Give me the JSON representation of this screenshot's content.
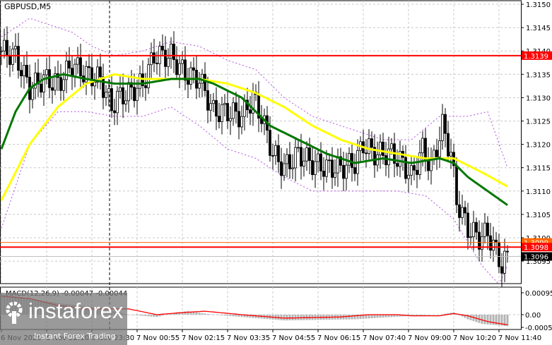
{
  "symbol": "GBPUSD,M5",
  "price_labels": [
    "1.3150",
    "1.3145",
    "1.3140",
    "1.3135",
    "1.3130",
    "1.3125",
    "1.3120",
    "1.3115",
    "1.3110",
    "1.3105",
    "1.3100",
    "1.3095"
  ],
  "markers": {
    "level_high": "1.3139",
    "level_low": "1.3098",
    "level_orange": "1.3099",
    "current": "1.3096"
  },
  "time_labels": [
    "6 Nov 2025",
    "6 Nov 22:10",
    "6 Nov 23:30",
    "7 Nov 00:55",
    "7 Nov 02:15",
    "7 Nov 03:35",
    "7 Nov 04:55",
    "7 Nov 06:15",
    "7 Nov 07:40",
    "7 Nov 09:00",
    "7 Nov 10:20",
    "7 Nov 11:40"
  ],
  "macd": {
    "label": "MACD(12,26,9) -0.00047 -0.00044",
    "axis": [
      "0.00095",
      "0.00",
      "-0.00055"
    ]
  },
  "watermark": {
    "brand": "instaforex",
    "tagline": "Instant Forex Trading"
  },
  "colors": {
    "ma_fast": "#007700",
    "ma_slow": "#ffff00",
    "bands": "#b050e0",
    "level": "#ff0000",
    "macd_signal": "#ff0000",
    "hist": "#b4b4b4"
  },
  "chart_data": {
    "type": "candlestick",
    "bars": 184,
    "close_waypoints": [
      [
        0,
        1.314
      ],
      [
        5,
        1.3139
      ],
      [
        10,
        1.3132
      ],
      [
        15,
        1.3134
      ],
      [
        20,
        1.3133
      ],
      [
        25,
        1.3137
      ],
      [
        30,
        1.3135
      ],
      [
        35,
        1.3134
      ],
      [
        39,
        1.3128
      ],
      [
        41,
        1.313
      ],
      [
        45,
        1.3131
      ],
      [
        50,
        1.3133
      ],
      [
        54,
        1.3139
      ],
      [
        60,
        1.3139
      ],
      [
        65,
        1.3135
      ],
      [
        70,
        1.3134
      ],
      [
        75,
        1.3127
      ],
      [
        80,
        1.3127
      ],
      [
        85,
        1.3126
      ],
      [
        89,
        1.313
      ],
      [
        92,
        1.3126
      ],
      [
        96,
        1.3118
      ],
      [
        100,
        1.3115
      ],
      [
        105,
        1.3118
      ],
      [
        110,
        1.3116
      ],
      [
        115,
        1.3115
      ],
      [
        120,
        1.3115
      ],
      [
        125,
        1.3116
      ],
      [
        128,
        1.312
      ],
      [
        132,
        1.3118
      ],
      [
        138,
        1.3118
      ],
      [
        142,
        1.3116
      ],
      [
        145,
        1.3113
      ],
      [
        149,
        1.3119
      ],
      [
        152,
        1.3115
      ],
      [
        156,
        1.3124
      ],
      [
        159,
        1.3118
      ],
      [
        161,
        1.3108
      ],
      [
        165,
        1.3102
      ],
      [
        169,
        1.31
      ],
      [
        172,
        1.3101
      ],
      [
        175,
        1.3097
      ],
      [
        177,
        1.3094
      ],
      [
        179,
        1.3096
      ]
    ],
    "ma_fast": [
      [
        0,
        1.3119
      ],
      [
        5,
        1.3127
      ],
      [
        10,
        1.3132
      ],
      [
        15,
        1.3134
      ],
      [
        22,
        1.3135
      ],
      [
        30,
        1.3134
      ],
      [
        40,
        1.3133
      ],
      [
        50,
        1.3133
      ],
      [
        60,
        1.3134
      ],
      [
        70,
        1.3134
      ],
      [
        75,
        1.3133
      ],
      [
        85,
        1.313
      ],
      [
        95,
        1.3124
      ],
      [
        105,
        1.3121
      ],
      [
        115,
        1.3118
      ],
      [
        125,
        1.3116
      ],
      [
        135,
        1.3117
      ],
      [
        145,
        1.3116
      ],
      [
        155,
        1.3117
      ],
      [
        160,
        1.3116
      ],
      [
        165,
        1.3113
      ],
      [
        172,
        1.311
      ],
      [
        179,
        1.3107
      ]
    ],
    "ma_slow": [
      [
        0,
        1.3108
      ],
      [
        10,
        1.312
      ],
      [
        20,
        1.3128
      ],
      [
        30,
        1.3133
      ],
      [
        40,
        1.3135
      ],
      [
        50,
        1.3134
      ],
      [
        60,
        1.3134
      ],
      [
        70,
        1.3134
      ],
      [
        80,
        1.3133
      ],
      [
        90,
        1.3131
      ],
      [
        100,
        1.3128
      ],
      [
        110,
        1.3124
      ],
      [
        120,
        1.3121
      ],
      [
        130,
        1.3119
      ],
      [
        140,
        1.3118
      ],
      [
        150,
        1.3117
      ],
      [
        160,
        1.3117
      ],
      [
        170,
        1.3114
      ],
      [
        179,
        1.3111
      ]
    ],
    "band_upper": [
      [
        0,
        1.3143
      ],
      [
        10,
        1.3147
      ],
      [
        15,
        1.3146
      ],
      [
        25,
        1.3144
      ],
      [
        32,
        1.3141
      ],
      [
        40,
        1.3139
      ],
      [
        50,
        1.314
      ],
      [
        60,
        1.3142
      ],
      [
        70,
        1.3141
      ],
      [
        80,
        1.3138
      ],
      [
        90,
        1.3136
      ],
      [
        100,
        1.313
      ],
      [
        110,
        1.3126
      ],
      [
        125,
        1.3123
      ],
      [
        135,
        1.3121
      ],
      [
        145,
        1.3121
      ],
      [
        155,
        1.3126
      ],
      [
        165,
        1.3126
      ],
      [
        172,
        1.3127
      ],
      [
        179,
        1.3115
      ]
    ],
    "band_lower": [
      [
        0,
        1.3102
      ],
      [
        10,
        1.312
      ],
      [
        20,
        1.3127
      ],
      [
        30,
        1.3127
      ],
      [
        40,
        1.3126
      ],
      [
        50,
        1.3126
      ],
      [
        60,
        1.3128
      ],
      [
        70,
        1.3124
      ],
      [
        80,
        1.3119
      ],
      [
        90,
        1.3117
      ],
      [
        100,
        1.3113
      ],
      [
        110,
        1.311
      ],
      [
        120,
        1.311
      ],
      [
        130,
        1.311
      ],
      [
        140,
        1.311
      ],
      [
        150,
        1.3109
      ],
      [
        160,
        1.3104
      ],
      [
        170,
        1.3094
      ],
      [
        176,
        1.309
      ],
      [
        179,
        1.3094
      ]
    ],
    "macd_hist": [
      [
        0,
        0.0009
      ],
      [
        10,
        0.0007
      ],
      [
        20,
        0.0005
      ],
      [
        35,
        0.0003
      ],
      [
        45,
        0.0
      ],
      [
        55,
        -0.0001
      ],
      [
        62,
        0.0001
      ],
      [
        66,
        0.00015
      ],
      [
        75,
        0.0
      ],
      [
        90,
        -0.00015
      ],
      [
        100,
        -0.00025
      ],
      [
        125,
        -0.0002
      ],
      [
        145,
        -5e-05
      ],
      [
        155,
        0.0
      ],
      [
        160,
        0.0001
      ],
      [
        165,
        -0.0002
      ],
      [
        170,
        -0.0004
      ],
      [
        179,
        -0.0005
      ]
    ],
    "macd_signal": [
      [
        0,
        0.0008
      ],
      [
        10,
        0.0007
      ],
      [
        20,
        0.0004
      ],
      [
        30,
        0.00025
      ],
      [
        45,
        0.00025
      ],
      [
        55,
        0.0
      ],
      [
        65,
        0.0001
      ],
      [
        72,
        0.00015
      ],
      [
        85,
        0.0
      ],
      [
        95,
        -0.0001
      ],
      [
        100,
        -0.00015
      ],
      [
        120,
        -0.0001
      ],
      [
        130,
        0.0
      ],
      [
        140,
        0.0
      ],
      [
        145,
        -5e-05
      ],
      [
        155,
        -5e-05
      ],
      [
        160,
        5e-05
      ],
      [
        165,
        -5e-05
      ],
      [
        172,
        -0.0003
      ],
      [
        179,
        -0.00044
      ]
    ],
    "ylim": [
      1.309,
      1.315
    ],
    "macd_ylim": [
      -0.00055,
      0.00095
    ]
  }
}
